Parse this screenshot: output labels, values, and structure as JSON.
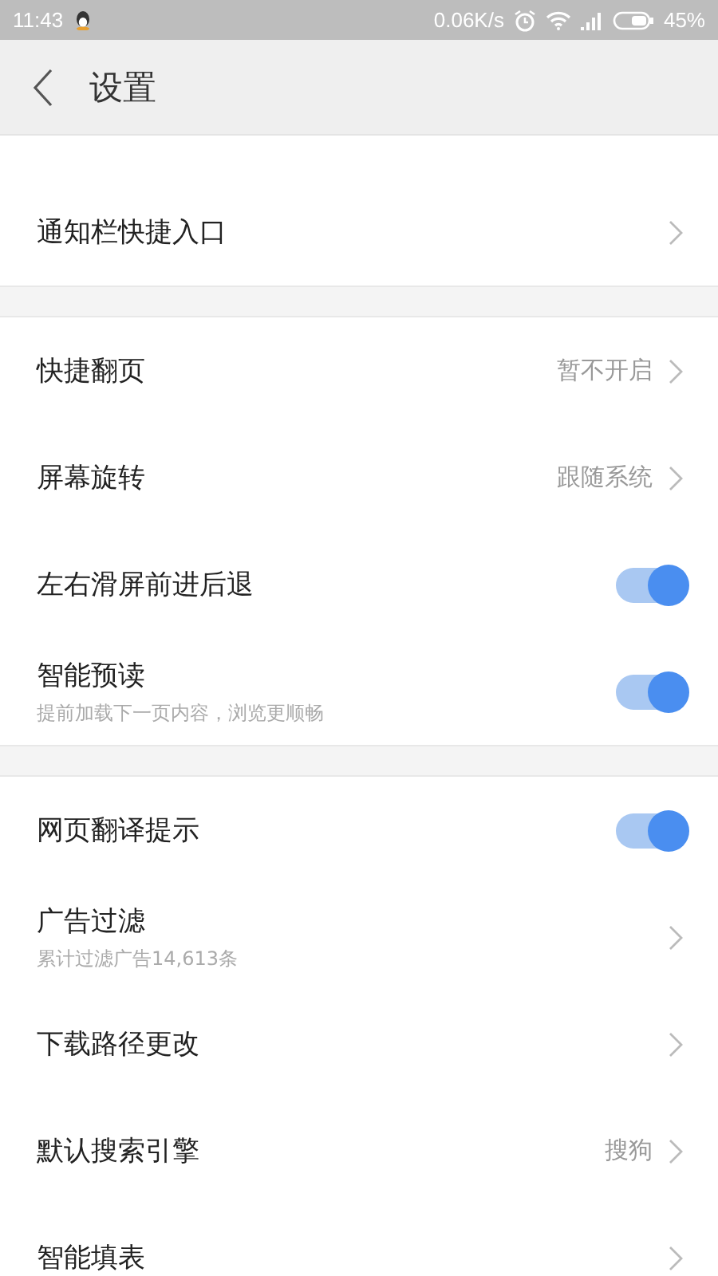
{
  "status_bar": {
    "time": "11:43",
    "speed": "0.06K/s",
    "battery": "45%"
  },
  "header": {
    "title": "设置"
  },
  "sections": [
    {
      "items": [
        {
          "kind": "link",
          "title": "通知栏快捷入口"
        }
      ]
    },
    {
      "items": [
        {
          "kind": "link",
          "title": "快捷翻页",
          "value": "暂不开启"
        },
        {
          "kind": "link",
          "title": "屏幕旋转",
          "value": "跟随系统"
        },
        {
          "kind": "toggle",
          "title": "左右滑屏前进后退",
          "on": true
        },
        {
          "kind": "toggle",
          "title": "智能预读",
          "subtitle": "提前加载下一页内容，浏览更顺畅",
          "on": true
        }
      ]
    },
    {
      "items": [
        {
          "kind": "toggle",
          "title": "网页翻译提示",
          "on": true
        },
        {
          "kind": "link",
          "title": "广告过滤",
          "subtitle": "累计过滤广告14,613条"
        },
        {
          "kind": "link",
          "title": "下载路径更改"
        },
        {
          "kind": "link",
          "title": "默认搜索引擎",
          "value": "搜狗"
        },
        {
          "kind": "link",
          "title": "智能填表"
        }
      ]
    }
  ]
}
